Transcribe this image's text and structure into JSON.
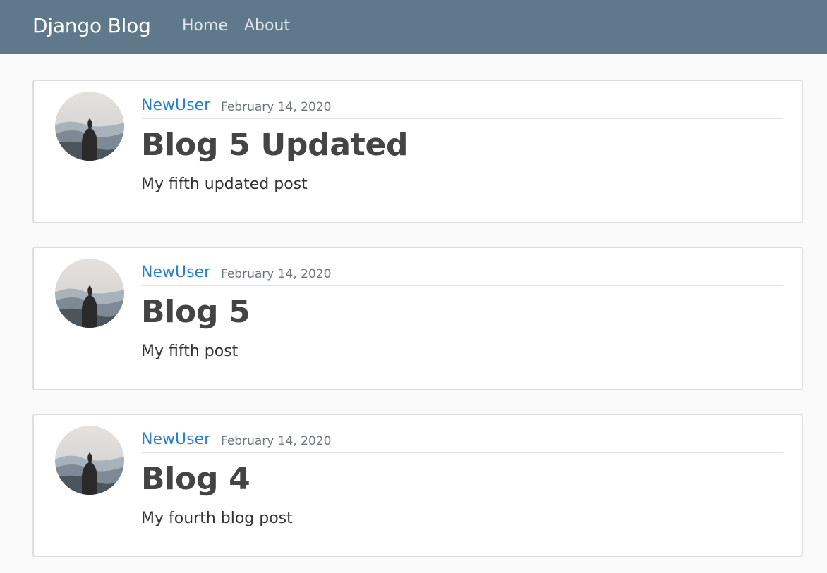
{
  "navbar": {
    "brand": "Django Blog",
    "links": [
      {
        "label": "Home"
      },
      {
        "label": "About"
      }
    ],
    "background": "#5f788a"
  },
  "posts": [
    {
      "author": "NewUser",
      "date": "February 14, 2020",
      "title": "Blog 5 Updated",
      "content": "My fifth updated post"
    },
    {
      "author": "NewUser",
      "date": "February 14, 2020",
      "title": "Blog 5",
      "content": "My fifth post"
    },
    {
      "author": "NewUser",
      "date": "February 14, 2020",
      "title": "Blog 4",
      "content": "My fourth blog post"
    }
  ],
  "colors": {
    "link": "#2b7fcf",
    "text": "#444444",
    "page_background": "#fafafa"
  }
}
